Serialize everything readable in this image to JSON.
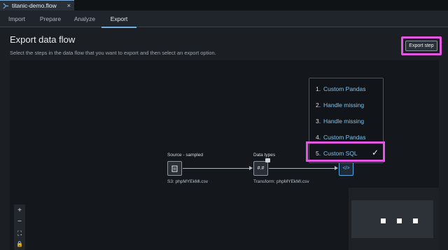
{
  "file_tab": {
    "name": "titanic-demo.flow",
    "close": "×"
  },
  "nav": {
    "tabs": [
      {
        "label": "Import"
      },
      {
        "label": "Prepare"
      },
      {
        "label": "Analyze"
      },
      {
        "label": "Export"
      }
    ],
    "active_tab": "Export"
  },
  "page": {
    "title": "Export data flow",
    "subtitle": "Select the steps in the data flow that you want to export and then select an export option.",
    "export_step_label": "Export step"
  },
  "flow": {
    "source": {
      "title": "Source - sampled",
      "caption": "S3: phpMYEkMl.csv",
      "icon_text": "▤"
    },
    "datatypes": {
      "title": "Data types",
      "caption": "Transform: phpMYEkMl.csv",
      "icon_text": "#.#"
    },
    "code_node": {
      "icon_text": "</>"
    }
  },
  "steps_menu": {
    "items": [
      {
        "num": "1.",
        "label": "Custom Pandas"
      },
      {
        "num": "2.",
        "label": "Handle missing"
      },
      {
        "num": "3.",
        "label": "Handle missing"
      },
      {
        "num": "4.",
        "label": "Custom Pandas"
      },
      {
        "num": "5.",
        "label": "Custom SQL",
        "selected": true
      }
    ],
    "check": "✓"
  },
  "zoom_controls": {
    "zoom_in": "+",
    "zoom_out": "−",
    "fit": "⛶",
    "lock": "🔒"
  },
  "colors": {
    "accent": "#6fb1e3",
    "highlight": "#e356e1",
    "link": "#7fc3ef",
    "background": "#1b1f24",
    "canvas": "#14171b"
  }
}
